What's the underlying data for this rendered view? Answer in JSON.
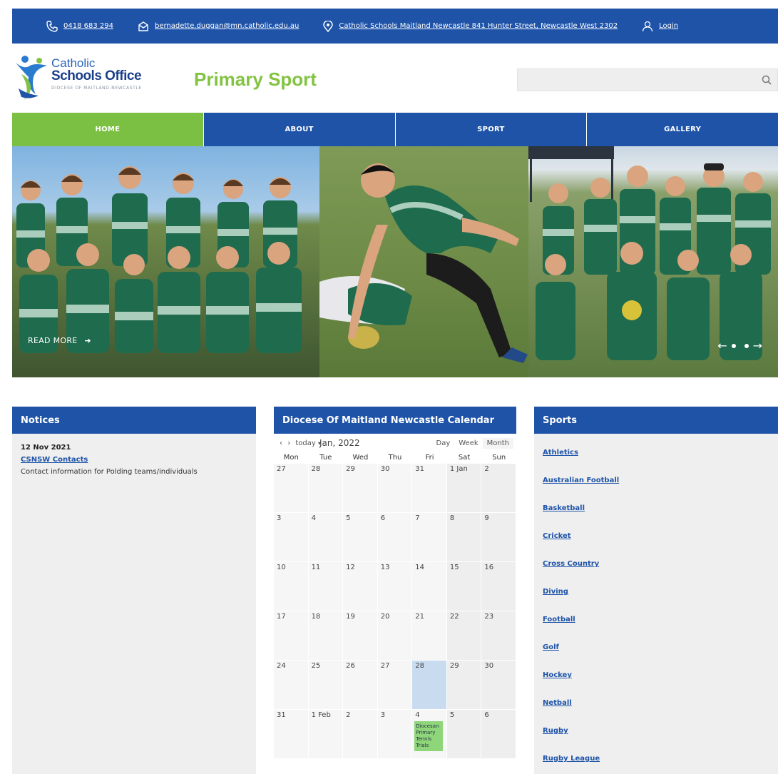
{
  "topbar": {
    "phone": "0418 683 294",
    "email": "bernadette.duggan@mn.catholic.edu.au",
    "address": "Catholic Schools Maitland Newcastle 841 Hunter Street, Newcastle West 2302",
    "login": "Login"
  },
  "header": {
    "logo_line1": "Catholic",
    "logo_line2": "Schools Office",
    "logo_line3": "DIOCESE OF MAITLAND-NEWCASTLE",
    "site_title": "Primary Sport",
    "search_placeholder": ""
  },
  "nav": {
    "items": [
      "HOME",
      "ABOUT",
      "SPORT",
      "GALLERY"
    ]
  },
  "hero": {
    "read_more": "READ MORE",
    "prev": "←",
    "next": "→"
  },
  "notices": {
    "title": "Notices",
    "date": "12 Nov 2021",
    "link": "CSNSW Contacts",
    "description": "Contact information for Polding teams/individuals"
  },
  "calendar": {
    "title": "Diocese Of Maitland Newcastle Calendar",
    "nav_prev": "‹",
    "nav_next": "›",
    "today": "today",
    "month_label": "Jan, 2022",
    "views": [
      "Day",
      "Week",
      "Month"
    ],
    "active_view": "Month",
    "dow": [
      "Mon",
      "Tue",
      "Wed",
      "Thu",
      "Fri",
      "Sat",
      "Sun"
    ],
    "weeks": [
      [
        "27",
        "28",
        "29",
        "30",
        "31",
        "1 Jan",
        "2"
      ],
      [
        "3",
        "4",
        "5",
        "6",
        "7",
        "8",
        "9"
      ],
      [
        "10",
        "11",
        "12",
        "13",
        "14",
        "15",
        "16"
      ],
      [
        "17",
        "18",
        "19",
        "20",
        "21",
        "22",
        "23"
      ],
      [
        "24",
        "25",
        "26",
        "27",
        "28",
        "29",
        "30"
      ],
      [
        "31",
        "1 Feb",
        "2",
        "3",
        "4",
        "5",
        "6"
      ]
    ],
    "today_date": "28",
    "event": {
      "date": "4",
      "title": "Diocesan Primary Tennis Trials"
    }
  },
  "sports": {
    "title": "Sports",
    "items": [
      "Athletics",
      "Australian Football",
      "Basketball",
      "Cricket",
      "Cross Country",
      "Diving",
      "Football",
      "Golf",
      "Hockey",
      "Netball",
      "Rugby",
      "Rugby League"
    ]
  },
  "colors": {
    "brand_blue": "#1e53a8",
    "brand_green": "#7bc043",
    "title_green": "#82c341"
  }
}
